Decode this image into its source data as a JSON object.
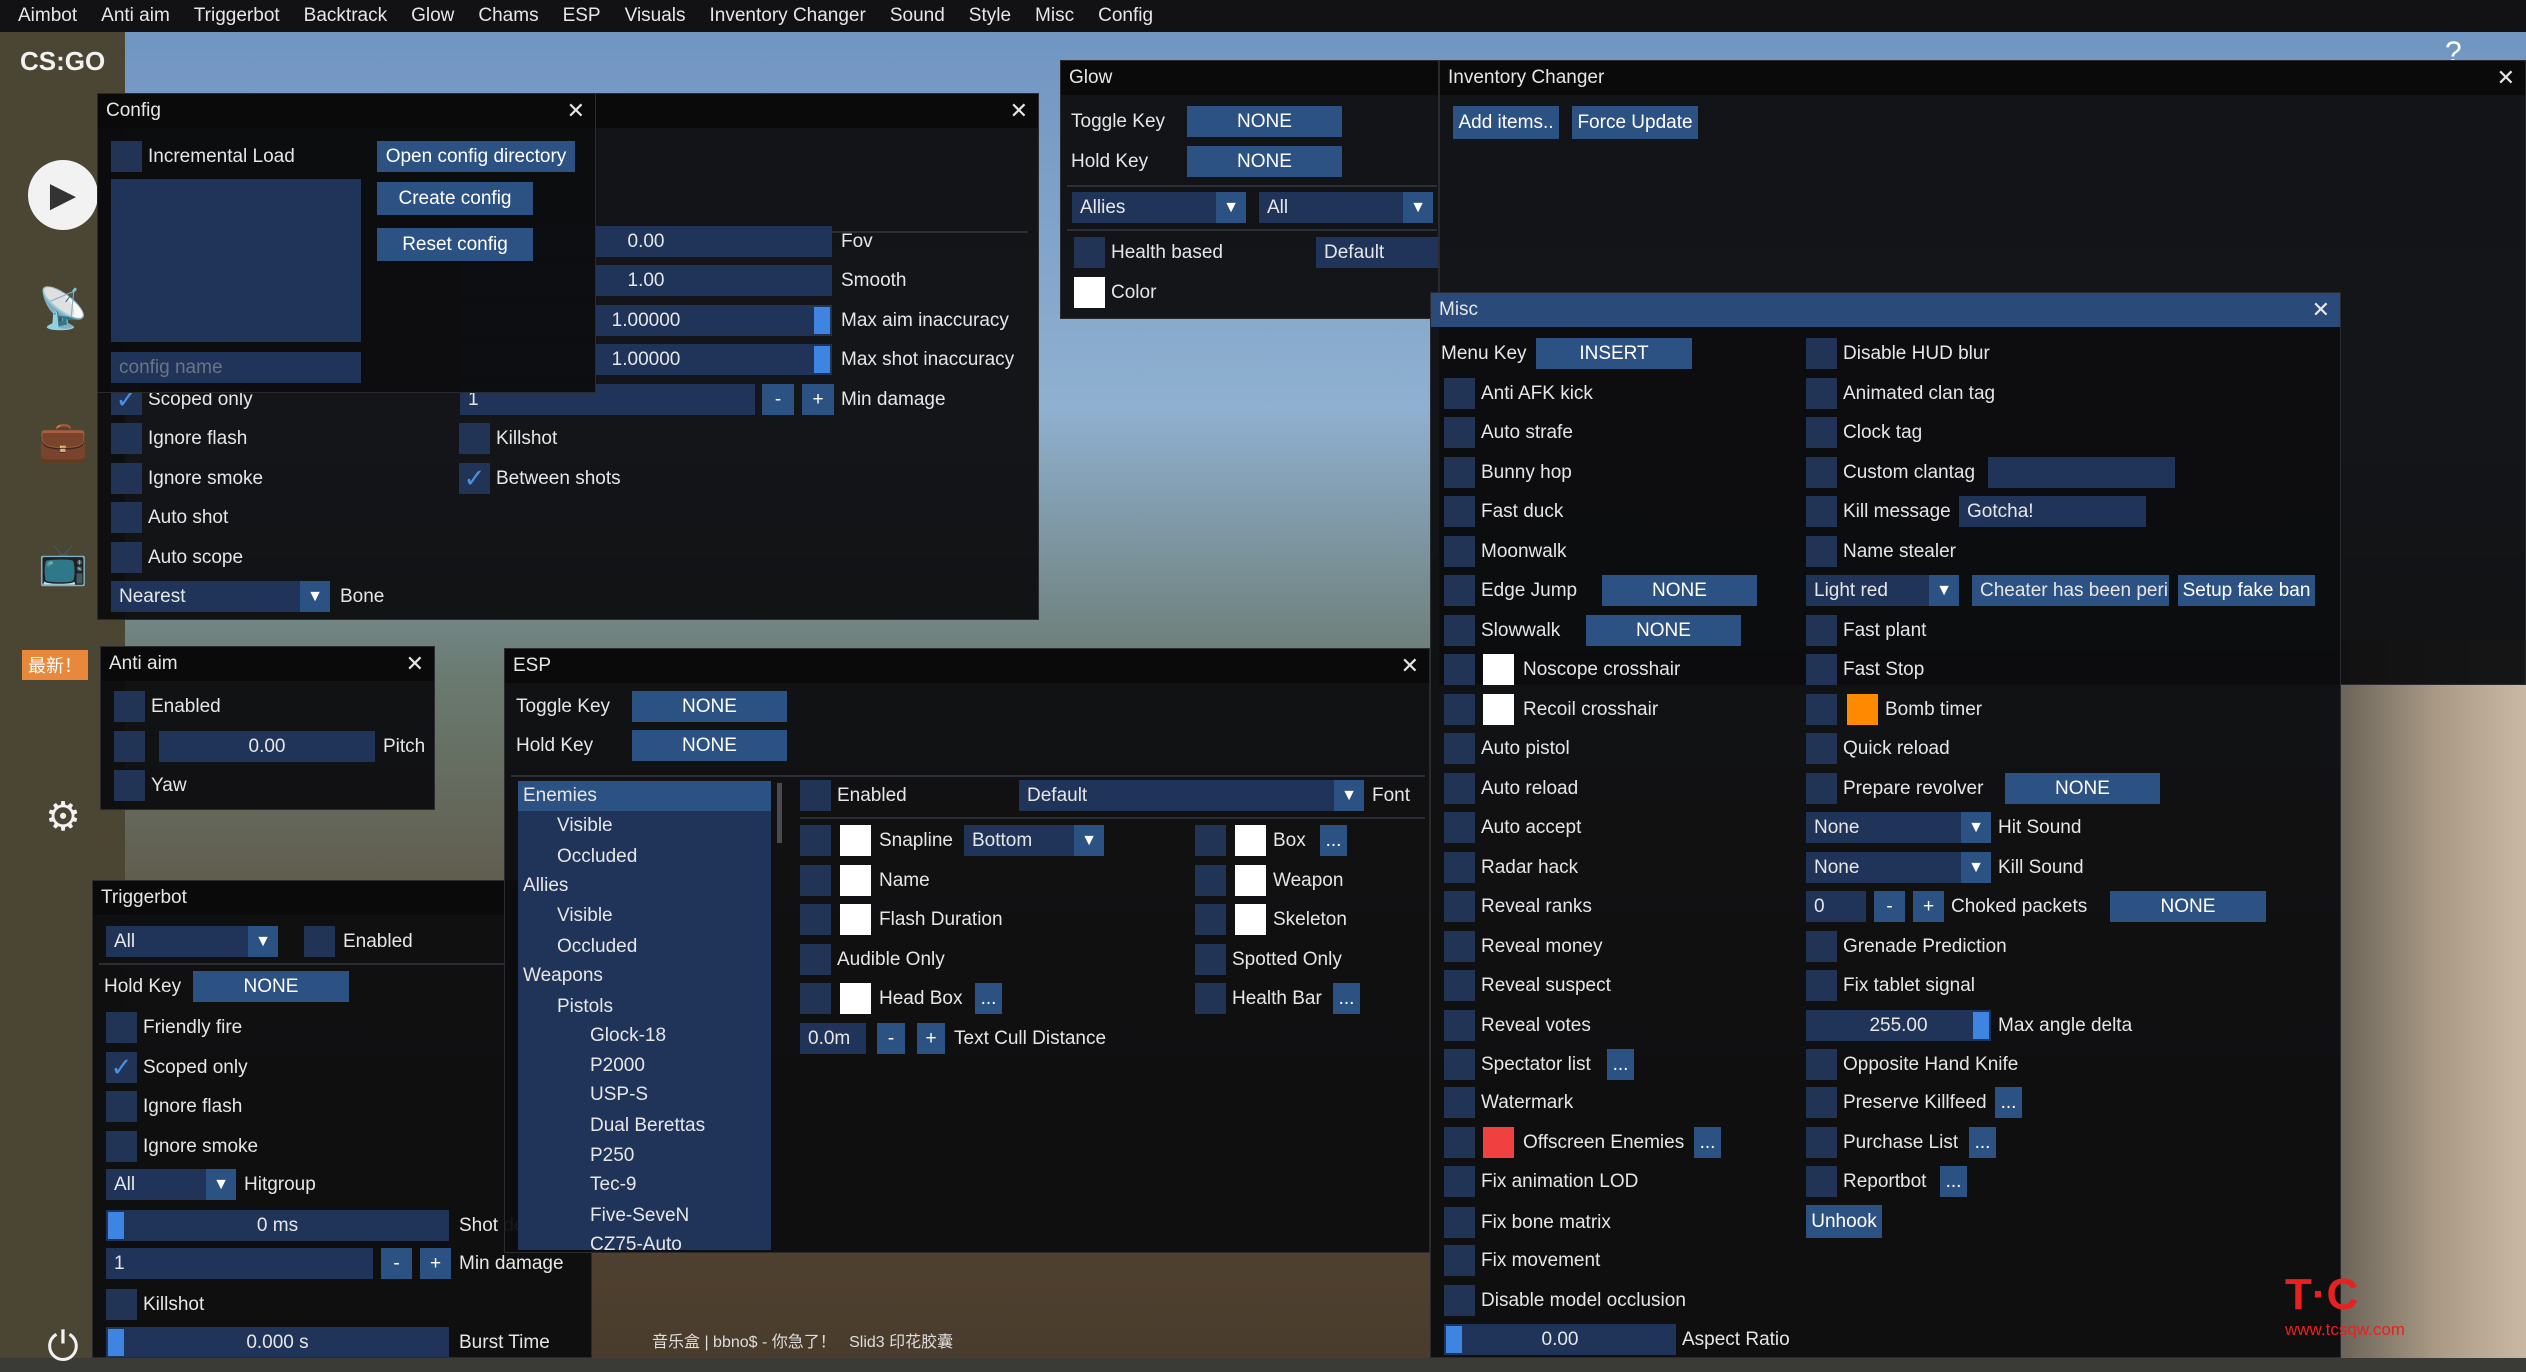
{
  "menubar": [
    "Aimbot",
    "Anti aim",
    "Triggerbot",
    "Backtrack",
    "Glow",
    "Chams",
    "ESP",
    "Visuals",
    "Inventory Changer",
    "Sound",
    "Style",
    "Misc",
    "Config"
  ],
  "sidebar": {
    "logo": "CS:GO",
    "badge": "最新！"
  },
  "colors": {
    "window_bg": "#0d0d0f",
    "frame": "#213456",
    "button": "#2c5183",
    "active_title": "#2a4a7a",
    "check": "#4a90e0",
    "bomb_timer": "#ff8a00",
    "offscreen": "#f04040"
  },
  "config": {
    "title": "Config",
    "incremental_load": "Incremental Load",
    "open_dir": "Open config directory",
    "create": "Create config",
    "reset": "Reset config",
    "name_placeholder": "config name"
  },
  "aimbot": {
    "fov": "0.00",
    "fov_label": "Fov",
    "smooth": "1.00",
    "smooth_label": "Smooth",
    "max_aim": "1.00000",
    "max_aim_label": "Max aim inaccuracy",
    "max_shot": "1.00000",
    "max_shot_label": "Max shot inaccuracy",
    "min_damage": "1",
    "min_damage_label": "Min damage",
    "minus": "-",
    "plus": "+",
    "scoped_only": "Scoped only",
    "ignore_flash": "Ignore flash",
    "ignore_smoke": "Ignore smoke",
    "auto_shot": "Auto shot",
    "auto_scope": "Auto scope",
    "bone_value": "Nearest",
    "bone_label": "Bone",
    "killshot": "Killshot",
    "between_shots": "Between shots"
  },
  "glow": {
    "title": "Glow",
    "toggle_key": "Toggle Key",
    "toggle_value": "NONE",
    "hold_key": "Hold Key",
    "hold_value": "NONE",
    "category": "Allies",
    "subcategory": "All",
    "health_based": "Health based",
    "style": "Default",
    "color": "Color"
  },
  "inventory": {
    "title": "Inventory Changer",
    "add_items": "Add items..",
    "force_update": "Force Update"
  },
  "antiaim": {
    "title": "Anti aim",
    "enabled": "Enabled",
    "pitch_value": "0.00",
    "pitch_label": "Pitch",
    "yaw": "Yaw"
  },
  "esp": {
    "title": "ESP",
    "toggle_key": "Toggle Key",
    "toggle_value": "NONE",
    "hold_key": "Hold Key",
    "hold_value": "NONE",
    "tree": [
      {
        "label": "Enemies",
        "level": 0,
        "selected": true
      },
      {
        "label": "Visible",
        "level": 1
      },
      {
        "label": "Occluded",
        "level": 1
      },
      {
        "label": "Allies",
        "level": 0
      },
      {
        "label": "Visible",
        "level": 1
      },
      {
        "label": "Occluded",
        "level": 1
      },
      {
        "label": "Weapons",
        "level": 0
      },
      {
        "label": "Pistols",
        "level": 1
      },
      {
        "label": "Glock-18",
        "level": 2
      },
      {
        "label": "P2000",
        "level": 2
      },
      {
        "label": "USP-S",
        "level": 2
      },
      {
        "label": "Dual Berettas",
        "level": 2
      },
      {
        "label": "P250",
        "level": 2
      },
      {
        "label": "Tec-9",
        "level": 2
      },
      {
        "label": "Five-SeveN",
        "level": 2
      },
      {
        "label": "CZ75-Auto",
        "level": 2
      }
    ],
    "enabled": "Enabled",
    "font_value": "Default",
    "font_label": "Font",
    "snapline": "Snapline",
    "snapline_value": "Bottom",
    "name": "Name",
    "flash_duration": "Flash Duration",
    "audible_only": "Audible Only",
    "head_box": "Head Box",
    "box": "Box",
    "weapon": "Weapon",
    "skeleton": "Skeleton",
    "spotted_only": "Spotted Only",
    "health_bar": "Health Bar",
    "more": "...",
    "cull_value": "0.0m",
    "cull_label": "Text Cull Distance",
    "minus": "-",
    "plus": "+"
  },
  "triggerbot": {
    "title": "Triggerbot",
    "weapon": "All",
    "enabled": "Enabled",
    "hold_key": "Hold Key",
    "hold_value": "NONE",
    "friendly_fire": "Friendly fire",
    "scoped_only": "Scoped only",
    "ignore_flash": "Ignore flash",
    "ignore_smoke": "Ignore smoke",
    "hitgroup_value": "All",
    "hitgroup": "Hitgroup",
    "shot_delay_value": "0 ms",
    "shot_delay": "Shot delay",
    "min_damage_value": "1",
    "min_damage": "Min damage",
    "minus": "-",
    "plus": "+",
    "killshot": "Killshot",
    "burst_value": "0.000 s",
    "burst": "Burst Time"
  },
  "misc": {
    "title": "Misc",
    "menu_key": "Menu Key",
    "menu_key_value": "INSERT",
    "left": [
      "Anti AFK kick",
      "Auto strafe",
      "Bunny hop",
      "Fast duck",
      "Moonwalk",
      "Edge Jump",
      "Slowwalk",
      "Noscope crosshair",
      "Recoil crosshair",
      "Auto pistol",
      "Auto reload",
      "Auto accept",
      "Radar hack",
      "Reveal ranks",
      "Reveal money",
      "Reveal suspect",
      "Reveal votes",
      "Spectator list",
      "Watermark",
      "Offscreen Enemies",
      "Fix animation LOD",
      "Fix bone matrix",
      "Fix movement",
      "Disable model occlusion"
    ],
    "edge_jump_key": "NONE",
    "slowwalk_key": "NONE",
    "aspect_value": "0.00",
    "aspect_label": "Aspect Ratio",
    "more": "...",
    "right": {
      "disable_hud_blur": "Disable HUD blur",
      "animated_clan_tag": "Animated clan tag",
      "clock_tag": "Clock tag",
      "custom_clantag": "Custom clantag",
      "custom_clantag_value": "",
      "kill_message": "Kill message",
      "kill_message_value": "Gotcha!",
      "name_stealer": "Name stealer",
      "ban_color": "Light red",
      "ban_text": "Cheater has been peri",
      "setup_fake_ban": "Setup fake ban",
      "fast_plant": "Fast plant",
      "fast_stop": "Fast Stop",
      "bomb_timer": "Bomb timer",
      "quick_reload": "Quick reload",
      "prepare_revolver": "Prepare revolver",
      "revolver_key": "NONE",
      "hit_sound_value": "None",
      "hit_sound": "Hit Sound",
      "kill_sound_value": "None",
      "kill_sound": "Kill Sound",
      "choked_value": "0",
      "minus": "-",
      "plus": "+",
      "choked": "Choked packets",
      "choked_key": "NONE",
      "grenade_prediction": "Grenade Prediction",
      "fix_tablet_signal": "Fix tablet signal",
      "max_angle_value": "255.00",
      "max_angle": "Max angle delta",
      "opposite_hand_knife": "Opposite Hand Knife",
      "preserve_killfeed": "Preserve Killfeed",
      "purchase_list": "Purchase List",
      "reportbot": "Reportbot",
      "unhook": "Unhook"
    }
  },
  "overlay": {
    "now_playing": "音乐盒 | bbno$ - 你急了！   Slid3 印花胶囊",
    "watermark": "TC社区 www.tcsqw.com"
  }
}
